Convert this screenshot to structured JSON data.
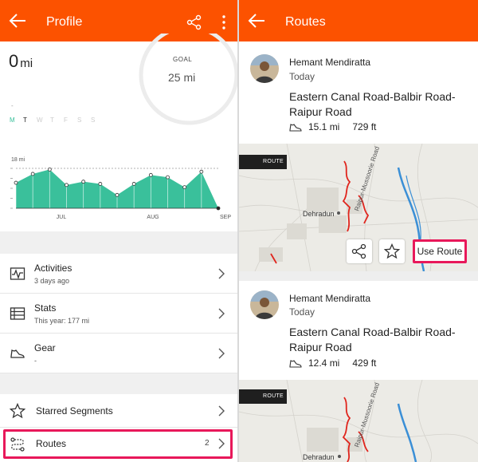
{
  "left": {
    "title": "Profile",
    "distance": {
      "value": "0",
      "unit": "mi"
    },
    "goal": {
      "label": "GOAL",
      "value": "25 mi",
      "progress": 0
    },
    "dash": "-",
    "week_days": [
      "M",
      "T",
      "W",
      "T",
      "F",
      "S",
      "S"
    ],
    "chart_data": {
      "type": "area",
      "ylabel_tick": "18 mi",
      "ylim": [
        0,
        18
      ],
      "x_labels": [
        "JUL",
        "AUG",
        "SEP"
      ],
      "values": [
        11.5,
        15.5,
        17.5,
        10.5,
        12,
        11,
        6,
        11,
        15,
        14,
        9.5,
        16.5,
        0
      ],
      "color": "#3ac09b"
    },
    "menu": [
      {
        "label": "Activities",
        "sub": "3 days ago"
      },
      {
        "label": "Stats",
        "sub": "This year: 177 mi"
      },
      {
        "label": "Gear",
        "sub": "-"
      }
    ],
    "starred_label": "Starred Segments",
    "routes_label": "Routes",
    "routes_count": "2"
  },
  "right": {
    "title": "Routes",
    "routes": [
      {
        "athlete": "Hemant Mendiratta",
        "when": "Today",
        "name": "Eastern Canal Road-Balbir Road-Raipur Road",
        "distance": "15.1 mi",
        "elevation": "729 ft",
        "tag": "ROUTE",
        "map_labels": {
          "city": "Dehradun",
          "road": "Raipur-Mussoorie Road"
        },
        "use_label": "Use Route"
      },
      {
        "athlete": "Hemant Mendiratta",
        "when": "Today",
        "name": "Eastern Canal Road-Balbir Road-Raipur Road",
        "distance": "12.4 mi",
        "elevation": "429 ft",
        "tag": "ROUTE",
        "map_labels": {
          "city": "Dehradun",
          "road": "Raipur-Mussoorie Road"
        }
      }
    ]
  },
  "colors": {
    "accent": "#fc5200",
    "highlight": "#e8185a",
    "chart": "#3ac09b",
    "route_line": "#e0241c",
    "river": "#3b8fd6"
  }
}
